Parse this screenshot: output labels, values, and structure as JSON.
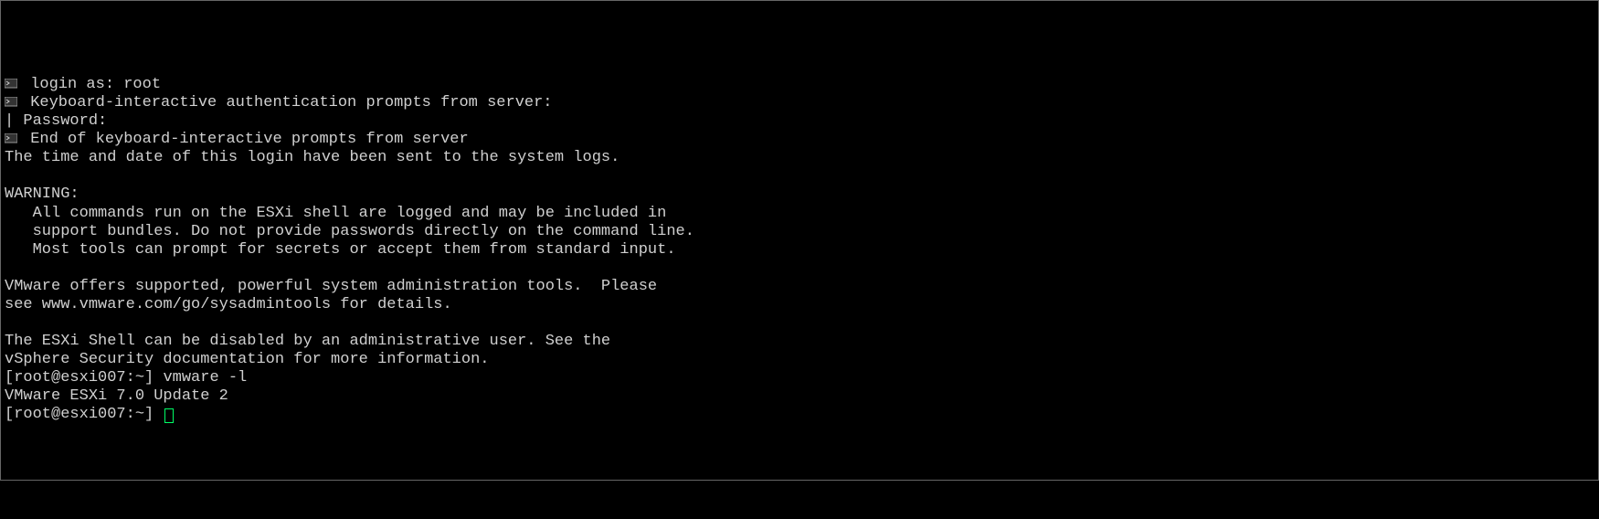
{
  "colors": {
    "fg": "#d0d0d0",
    "bg": "#000000",
    "cursor": "#00ff66"
  },
  "login_line": "login as: root",
  "auth_prompt": "Keyboard-interactive authentication prompts from server:",
  "password_line": "| Password:",
  "end_prompts": "End of keyboard-interactive prompts from server",
  "time_and_date": "The time and date of this login have been sent to the system logs.",
  "warning_header": "WARNING:",
  "warning_l1": "   All commands run on the ESXi shell are logged and may be included in",
  "warning_l2": "   support bundles. Do not provide passwords directly on the command line.",
  "warning_l3": "   Most tools can prompt for secrets or accept them from standard input.",
  "vmware_offer_l1": "VMware offers supported, powerful system administration tools.  Please",
  "vmware_offer_l2": "see www.vmware.com/go/sysadmintools for details.",
  "esxi_shell_l1": "The ESXi Shell can be disabled by an administrative user. See the",
  "esxi_shell_l2": "vSphere Security documentation for more information.",
  "prompt": "[root@esxi007:~]",
  "cmd1": "vmware -l",
  "cmd1_output": "VMware ESXi 7.0 Update 2",
  "cmd2": ""
}
